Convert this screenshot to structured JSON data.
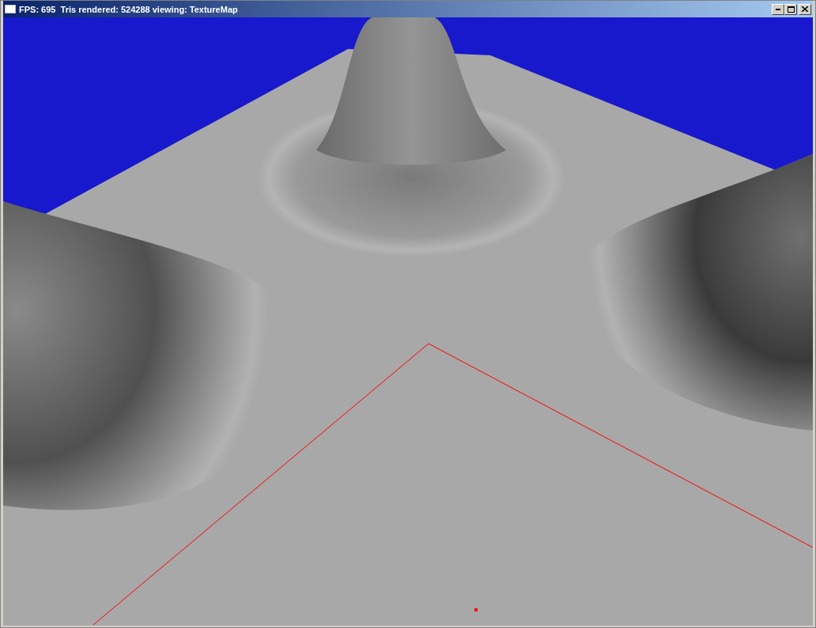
{
  "window": {
    "title": "FPS: 695  Tris rendered: 524288 viewing: TextureMap"
  }
}
